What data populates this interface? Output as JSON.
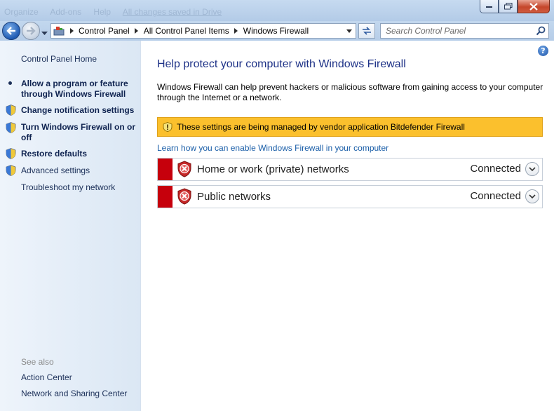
{
  "window": {
    "faded_menu": [
      "Organize",
      "Add-ons",
      "Help",
      "All changes saved in Drive"
    ]
  },
  "address": {
    "crumbs": [
      "Control Panel",
      "All Control Panel Items",
      "Windows Firewall"
    ],
    "search_placeholder": "Search Control Panel"
  },
  "sidebar": {
    "home": "Control Panel Home",
    "items": [
      {
        "label": "Allow a program or feature through Windows Firewall",
        "icon": "bullet"
      },
      {
        "label": "Change notification settings",
        "icon": "uac-shield-icon"
      },
      {
        "label": "Turn Windows Firewall on or off",
        "icon": "uac-shield-icon"
      },
      {
        "label": "Restore defaults",
        "icon": "uac-shield-icon"
      },
      {
        "label": "Advanced settings",
        "icon": "uac-shield-icon"
      },
      {
        "label": "Troubleshoot my network",
        "icon": "none"
      }
    ],
    "see_also": {
      "heading": "See also",
      "links": [
        "Action Center",
        "Network and Sharing Center"
      ]
    }
  },
  "main": {
    "title": "Help protect your computer with Windows Firewall",
    "description": "Windows Firewall can help prevent hackers or malicious software from gaining access to your computer through the Internet or a network.",
    "warning": "These settings are being managed by vendor application Bitdefender Firewall",
    "learn_link": "Learn how you can enable Windows Firewall in your computer",
    "networks": [
      {
        "name": "Home or work (private) networks",
        "status": "Connected"
      },
      {
        "name": "Public networks",
        "status": "Connected"
      }
    ]
  },
  "colors": {
    "warning_bg": "#fbc02d",
    "status_red": "#c6000c",
    "title_blue": "#1e3287",
    "link_blue": "#1a5ea8"
  }
}
